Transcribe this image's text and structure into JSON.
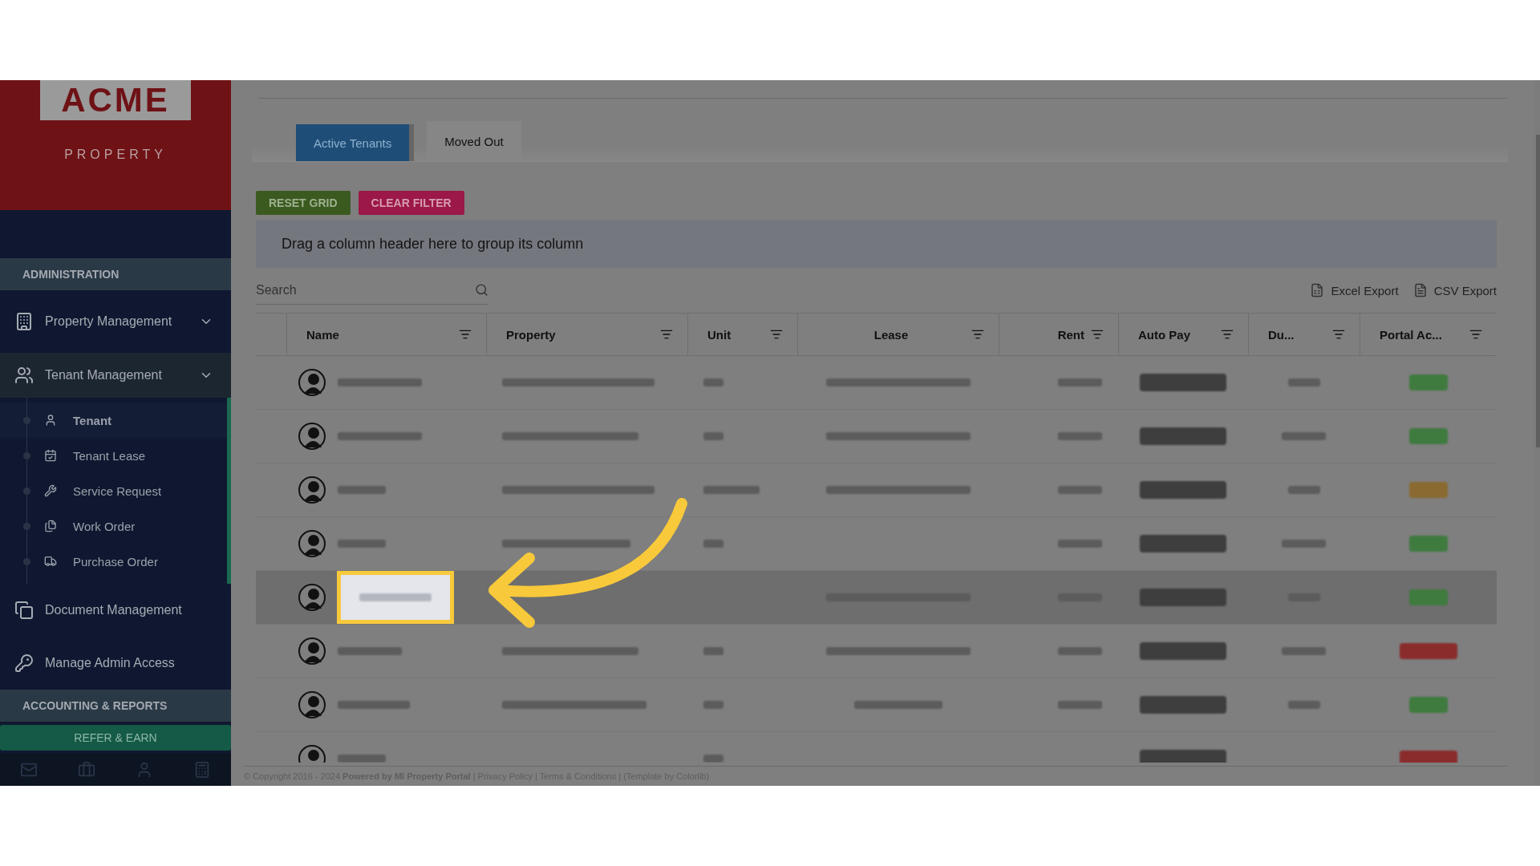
{
  "logo": {
    "title": "ACME",
    "subtitle": "PROPERTY"
  },
  "sidebar": {
    "sections": [
      {
        "header": "ADMINISTRATION",
        "items": [
          {
            "label": "Property Management",
            "selected": false
          },
          {
            "label": "Tenant Management",
            "selected": true,
            "children": [
              {
                "label": "Tenant",
                "selected": true
              },
              {
                "label": "Tenant Lease",
                "selected": false
              },
              {
                "label": "Service Request",
                "selected": false
              },
              {
                "label": "Work Order",
                "selected": false
              },
              {
                "label": "Purchase Order",
                "selected": false
              }
            ]
          },
          {
            "label": "Document Management",
            "selected": false
          },
          {
            "label": "Manage Admin Access",
            "selected": false
          }
        ]
      },
      {
        "header": "ACCOUNTING & REPORTS"
      }
    ],
    "refer_button": "REFER & EARN"
  },
  "tabs": [
    {
      "label": "Active Tenants",
      "selected": true
    },
    {
      "label": "Moved Out",
      "selected": false
    }
  ],
  "buttons": [
    {
      "label": "RESET GRID",
      "kind": "reset"
    },
    {
      "label": "CLEAR FILTER",
      "kind": "clear"
    }
  ],
  "group_panel": "Drag a column header here to group its column",
  "search": {
    "placeholder": "Search"
  },
  "exports": [
    "Excel Export",
    "CSV Export"
  ],
  "table": {
    "columns": [
      "Name",
      "Property",
      "Unit",
      "Lease",
      "Rent",
      "Auto Pay",
      "Du...",
      "Portal Ac..."
    ],
    "rows": [
      {
        "selected": false,
        "color": "#3f7a3f"
      },
      {
        "selected": false,
        "color": "#3f7a3f"
      },
      {
        "selected": false,
        "color": "#8a6a30"
      },
      {
        "selected": false,
        "color": "#3f7a3f"
      },
      {
        "selected": true,
        "color": "#3f7a3f"
      },
      {
        "selected": false,
        "color": "#8a2c2c"
      },
      {
        "selected": false,
        "color": "#3f7a3f"
      },
      {
        "selected": false,
        "color": "#8a2c2c"
      }
    ]
  },
  "footer": "© Copyright 2016 - 2024 **Powered by MI Property Portal** | Privacy Policy | Terms & Conditions | (Template by Colorlib)"
}
